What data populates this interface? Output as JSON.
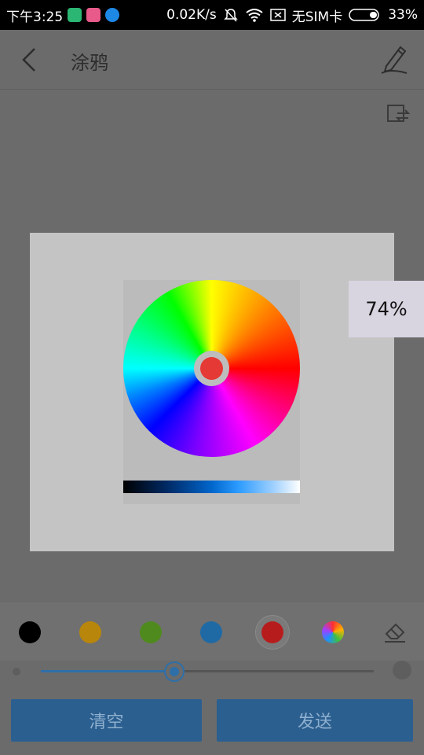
{
  "status_bar": {
    "time": "下午3:25",
    "speed": "0.02K/s",
    "sim": "无SIM卡",
    "battery": "33%"
  },
  "header": {
    "title": "涂鸦"
  },
  "color_dialog": {
    "selected_color": "#e53935",
    "brightness_tooltip": "74%"
  },
  "palette": {
    "colors": [
      "#000000",
      "#b8860b",
      "#4f8a1e",
      "#1f6aa5",
      "#b71c1c"
    ],
    "selected_index": 4
  },
  "brush_size": {
    "value_fraction": 0.4
  },
  "actions": {
    "clear_label": "清空",
    "send_label": "发送"
  }
}
